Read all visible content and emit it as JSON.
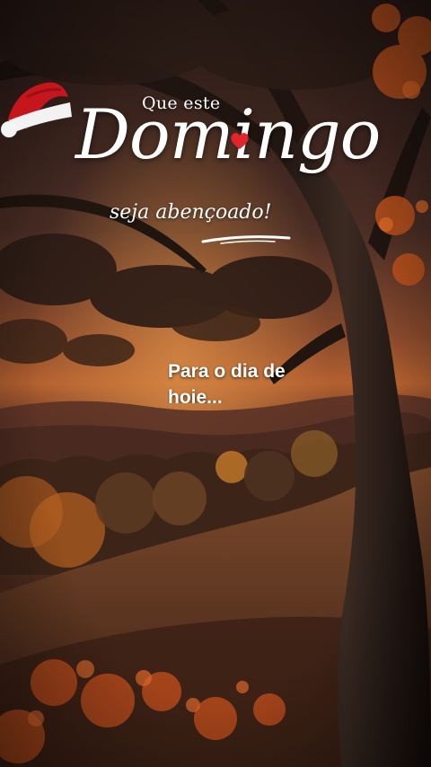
{
  "greeting": {
    "line_top": "Que este",
    "line_main": "Domingo",
    "line_sub": "seja abençoado!"
  },
  "caption": {
    "line1": "Para o dia de",
    "line2": "hoje..."
  },
  "colors": {
    "sky_top": "#3a2520",
    "sky_glow": "#b3602f",
    "hill": "#6e3f24",
    "foliage_orange": "#c9641f",
    "heart_red": "#e0262b",
    "hat_red": "#c4161c",
    "text": "#ffffff"
  },
  "decorations": {
    "heart_icon": "heart-icon",
    "hat_icon": "santa-hat-icon"
  }
}
